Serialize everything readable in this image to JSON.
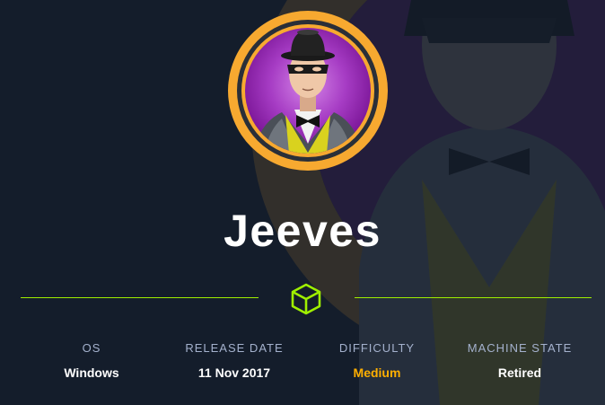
{
  "machine": {
    "name": "Jeeves"
  },
  "stats": [
    {
      "label": "OS",
      "value": "Windows"
    },
    {
      "label": "RELEASE DATE",
      "value": "11 Nov 2017"
    },
    {
      "label": "DIFFICULTY",
      "value": "Medium"
    },
    {
      "label": "MACHINE STATE",
      "value": "Retired"
    }
  ],
  "icons": {
    "divider": "cube-icon",
    "avatar": "butler-avatar-icon"
  },
  "colors": {
    "background": "#141d2b",
    "accent_green": "#9fef00",
    "difficulty_medium": "#ffaf00",
    "label_grey": "#a4b1cd",
    "avatar_ring": "#f7a930",
    "avatar_inner": "#8a1ea8"
  }
}
